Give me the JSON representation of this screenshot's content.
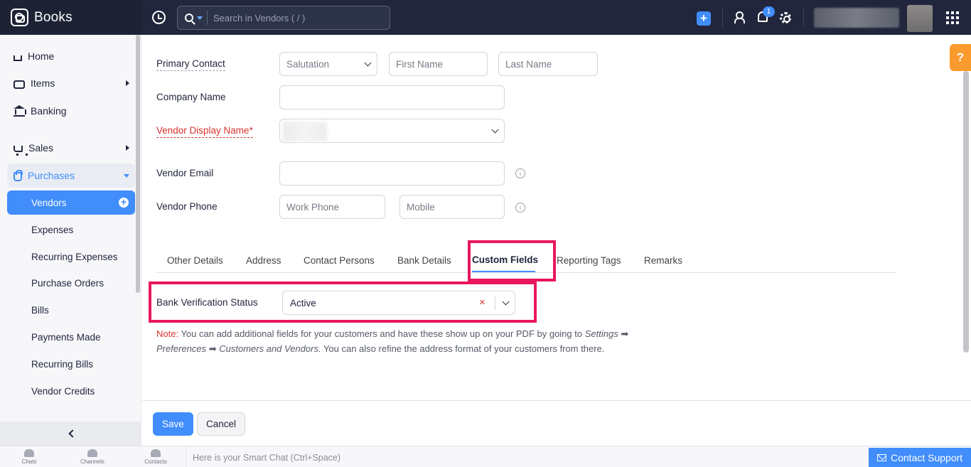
{
  "app": {
    "name": "Books"
  },
  "search": {
    "placeholder": "Search in Vendors ( / )"
  },
  "header": {
    "notification_count": "1"
  },
  "sidebar": {
    "items": [
      {
        "label": "Home"
      },
      {
        "label": "Items"
      },
      {
        "label": "Banking"
      },
      {
        "label": "Sales"
      },
      {
        "label": "Purchases"
      }
    ],
    "purchases_subitems": [
      {
        "label": "Vendors"
      },
      {
        "label": "Expenses"
      },
      {
        "label": "Recurring Expenses"
      },
      {
        "label": "Purchase Orders"
      },
      {
        "label": "Bills"
      },
      {
        "label": "Payments Made"
      },
      {
        "label": "Recurring Bills"
      },
      {
        "label": "Vendor Credits"
      }
    ]
  },
  "form": {
    "primary_contact_label": "Primary Contact",
    "salutation_placeholder": "Salutation",
    "first_name_placeholder": "First Name",
    "last_name_placeholder": "Last Name",
    "company_name_label": "Company Name",
    "display_name_label": "Vendor Display Name*",
    "email_label": "Vendor Email",
    "phone_label": "Vendor Phone",
    "work_phone_placeholder": "Work Phone",
    "mobile_placeholder": "Mobile"
  },
  "tabs": [
    {
      "label": "Other Details"
    },
    {
      "label": "Address"
    },
    {
      "label": "Contact Persons"
    },
    {
      "label": "Bank Details"
    },
    {
      "label": "Custom Fields"
    },
    {
      "label": "Reporting Tags"
    },
    {
      "label": "Remarks"
    }
  ],
  "custom_fields": {
    "bank_verification_label": "Bank Verification Status",
    "bank_verification_value": "Active",
    "note_label": "Note:",
    "note_text_1": " You can add additional fields for your customers and have these show up on your PDF by going to ",
    "note_path_1": "Settings",
    "note_path_2": "Preferences",
    "note_path_3": "Customers and Vendors.",
    "note_text_2": " You can also refine the address format of your customers from there."
  },
  "actions": {
    "save": "Save",
    "cancel": "Cancel"
  },
  "bottom_bar": {
    "chats": "Chats",
    "channels": "Channels",
    "contacts": "Contacts",
    "smart_chat": "Here is your Smart Chat (Ctrl+Space)",
    "contact_support": "Contact Support"
  },
  "colors": {
    "accent": "#408dfb",
    "highlight": "#e8175d",
    "required": "#d6332e",
    "topbar": "#21263c"
  }
}
